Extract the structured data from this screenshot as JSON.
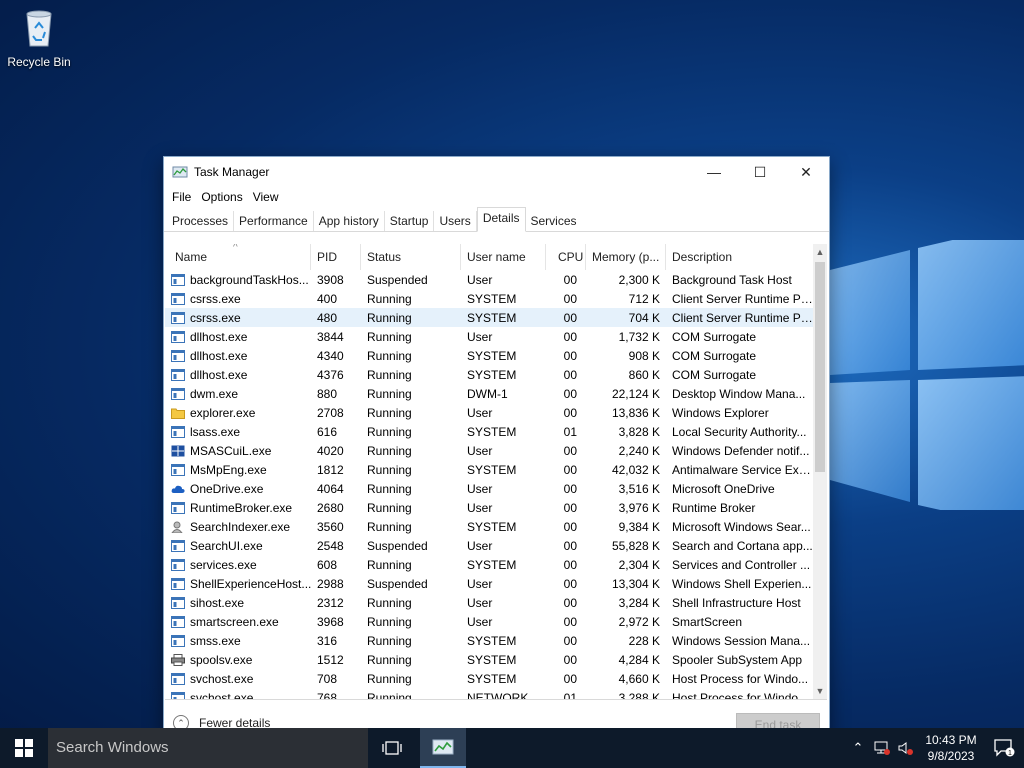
{
  "desktop": {
    "recycle_bin_label": "Recycle Bin"
  },
  "window": {
    "title": "Task Manager",
    "min_glyph": "—",
    "max_glyph": "☐",
    "close_glyph": "✕"
  },
  "menu": {
    "file": "File",
    "options": "Options",
    "view": "View"
  },
  "tabs": [
    "Processes",
    "Performance",
    "App history",
    "Startup",
    "Users",
    "Details",
    "Services"
  ],
  "active_tab": "Details",
  "columns": {
    "name": "Name",
    "pid": "PID",
    "status": "Status",
    "user": "User name",
    "cpu": "CPU",
    "memory": "Memory (p...",
    "description": "Description"
  },
  "sort_glyph": "^",
  "selected_row": 2,
  "rows": [
    {
      "name": "backgroundTaskHos...",
      "pid": "3908",
      "status": "Suspended",
      "user": "User",
      "cpu": "00",
      "memory": "2,300 K",
      "description": "Background Task Host",
      "icon": "app-window-icon"
    },
    {
      "name": "csrss.exe",
      "pid": "400",
      "status": "Running",
      "user": "SYSTEM",
      "cpu": "00",
      "memory": "712 K",
      "description": "Client Server Runtime Pr...",
      "icon": "app-window-icon"
    },
    {
      "name": "csrss.exe",
      "pid": "480",
      "status": "Running",
      "user": "SYSTEM",
      "cpu": "00",
      "memory": "704 K",
      "description": "Client Server Runtime Pr...",
      "icon": "app-window-icon"
    },
    {
      "name": "dllhost.exe",
      "pid": "3844",
      "status": "Running",
      "user": "User",
      "cpu": "00",
      "memory": "1,732 K",
      "description": "COM Surrogate",
      "icon": "app-window-icon"
    },
    {
      "name": "dllhost.exe",
      "pid": "4340",
      "status": "Running",
      "user": "SYSTEM",
      "cpu": "00",
      "memory": "908 K",
      "description": "COM Surrogate",
      "icon": "app-window-icon"
    },
    {
      "name": "dllhost.exe",
      "pid": "4376",
      "status": "Running",
      "user": "SYSTEM",
      "cpu": "00",
      "memory": "860 K",
      "description": "COM Surrogate",
      "icon": "app-window-icon"
    },
    {
      "name": "dwm.exe",
      "pid": "880",
      "status": "Running",
      "user": "DWM-1",
      "cpu": "00",
      "memory": "22,124 K",
      "description": "Desktop Window Mana...",
      "icon": "app-window-icon"
    },
    {
      "name": "explorer.exe",
      "pid": "2708",
      "status": "Running",
      "user": "User",
      "cpu": "00",
      "memory": "13,836 K",
      "description": "Windows Explorer",
      "icon": "folder-icon"
    },
    {
      "name": "lsass.exe",
      "pid": "616",
      "status": "Running",
      "user": "SYSTEM",
      "cpu": "01",
      "memory": "3,828 K",
      "description": "Local Security Authority...",
      "icon": "app-window-icon"
    },
    {
      "name": "MSASCuiL.exe",
      "pid": "4020",
      "status": "Running",
      "user": "User",
      "cpu": "00",
      "memory": "2,240 K",
      "description": "Windows Defender notif...",
      "icon": "shield-icon"
    },
    {
      "name": "MsMpEng.exe",
      "pid": "1812",
      "status": "Running",
      "user": "SYSTEM",
      "cpu": "00",
      "memory": "42,032 K",
      "description": "Antimalware Service Exe...",
      "icon": "app-window-icon"
    },
    {
      "name": "OneDrive.exe",
      "pid": "4064",
      "status": "Running",
      "user": "User",
      "cpu": "00",
      "memory": "3,516 K",
      "description": "Microsoft OneDrive",
      "icon": "cloud-icon"
    },
    {
      "name": "RuntimeBroker.exe",
      "pid": "2680",
      "status": "Running",
      "user": "User",
      "cpu": "00",
      "memory": "3,976 K",
      "description": "Runtime Broker",
      "icon": "app-window-icon"
    },
    {
      "name": "SearchIndexer.exe",
      "pid": "3560",
      "status": "Running",
      "user": "SYSTEM",
      "cpu": "00",
      "memory": "9,384 K",
      "description": "Microsoft Windows Sear...",
      "icon": "person-search-icon"
    },
    {
      "name": "SearchUI.exe",
      "pid": "2548",
      "status": "Suspended",
      "user": "User",
      "cpu": "00",
      "memory": "55,828 K",
      "description": "Search and Cortana app...",
      "icon": "app-window-icon"
    },
    {
      "name": "services.exe",
      "pid": "608",
      "status": "Running",
      "user": "SYSTEM",
      "cpu": "00",
      "memory": "2,304 K",
      "description": "Services and Controller ...",
      "icon": "app-window-icon"
    },
    {
      "name": "ShellExperienceHost....",
      "pid": "2988",
      "status": "Suspended",
      "user": "User",
      "cpu": "00",
      "memory": "13,304 K",
      "description": "Windows Shell Experien...",
      "icon": "app-window-icon"
    },
    {
      "name": "sihost.exe",
      "pid": "2312",
      "status": "Running",
      "user": "User",
      "cpu": "00",
      "memory": "3,284 K",
      "description": "Shell Infrastructure Host",
      "icon": "app-window-icon"
    },
    {
      "name": "smartscreen.exe",
      "pid": "3968",
      "status": "Running",
      "user": "User",
      "cpu": "00",
      "memory": "2,972 K",
      "description": "SmartScreen",
      "icon": "app-window-icon"
    },
    {
      "name": "smss.exe",
      "pid": "316",
      "status": "Running",
      "user": "SYSTEM",
      "cpu": "00",
      "memory": "228 K",
      "description": "Windows Session Mana...",
      "icon": "app-window-icon"
    },
    {
      "name": "spoolsv.exe",
      "pid": "1512",
      "status": "Running",
      "user": "SYSTEM",
      "cpu": "00",
      "memory": "4,284 K",
      "description": "Spooler SubSystem App",
      "icon": "printer-icon"
    },
    {
      "name": "svchost.exe",
      "pid": "708",
      "status": "Running",
      "user": "SYSTEM",
      "cpu": "00",
      "memory": "4,660 K",
      "description": "Host Process for Windo...",
      "icon": "app-window-icon"
    },
    {
      "name": "svchost.exe",
      "pid": "768",
      "status": "Running",
      "user": "NETWORK ...",
      "cpu": "01",
      "memory": "3,288 K",
      "description": "Host Process for Windo...",
      "icon": "app-window-icon"
    }
  ],
  "footer": {
    "fewer_details": "Fewer details",
    "end_task": "End task"
  },
  "taskbar": {
    "search_placeholder": "Search Windows",
    "time": "10:43 PM",
    "date": "9/8/2023",
    "notification_count": "1"
  }
}
